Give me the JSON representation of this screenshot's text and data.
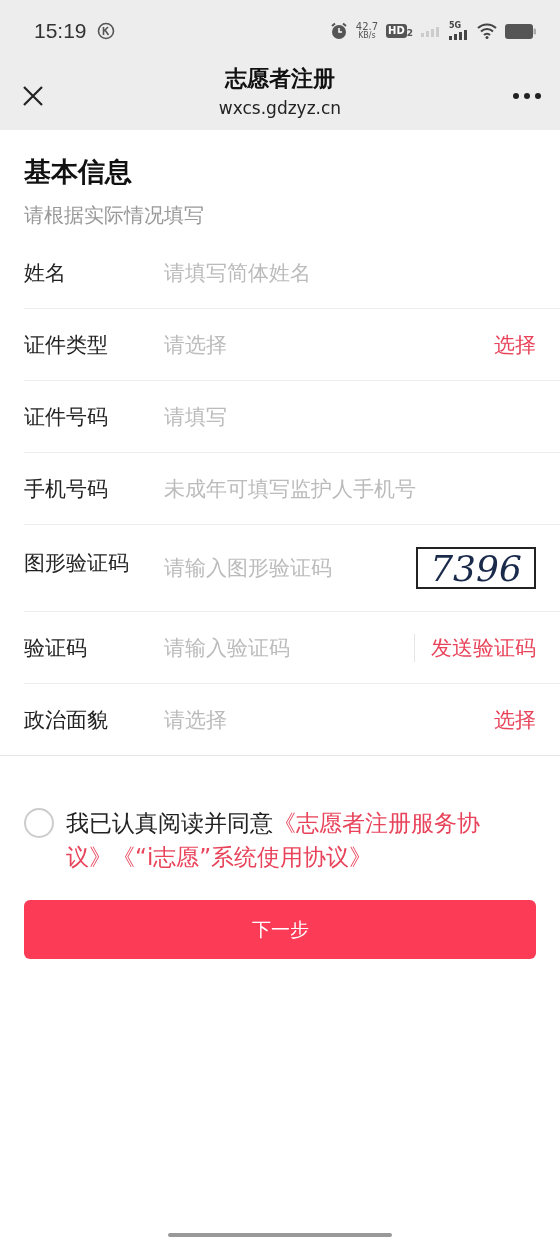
{
  "status_bar": {
    "time": "15:19",
    "speed": "42.7",
    "speed_unit": "KB/s",
    "hd": "HD",
    "hd_sub": "2",
    "network": "5G"
  },
  "nav": {
    "title": "志愿者注册",
    "url": "wxcs.gdzyz.cn"
  },
  "section": {
    "title": "基本信息",
    "subtitle": "请根据实际情况填写"
  },
  "fields": [
    {
      "kind": "text",
      "label": "姓名",
      "placeholder": "请填写简体姓名"
    },
    {
      "kind": "select",
      "label": "证件类型",
      "placeholder": "请选择",
      "action": "选择"
    },
    {
      "kind": "text",
      "label": "证件号码",
      "placeholder": "请填写"
    },
    {
      "kind": "text",
      "label": "手机号码",
      "placeholder": "未成年可填写监护人手机号"
    },
    {
      "kind": "captcha",
      "label": "图形验证码",
      "placeholder": "请输入图形验证码",
      "captcha": "7396"
    },
    {
      "kind": "sms",
      "label": "验证码",
      "placeholder": "请输入验证码",
      "action": "发送验证码"
    },
    {
      "kind": "select",
      "label": "政治面貌",
      "placeholder": "请选择",
      "action": "选择"
    }
  ],
  "agreement": {
    "checked": false,
    "text": "我已认真阅读并同意",
    "links": [
      "《志愿者注册服务协议》",
      "《“i志愿”系统使用协议》"
    ]
  },
  "next_button": "下一步"
}
